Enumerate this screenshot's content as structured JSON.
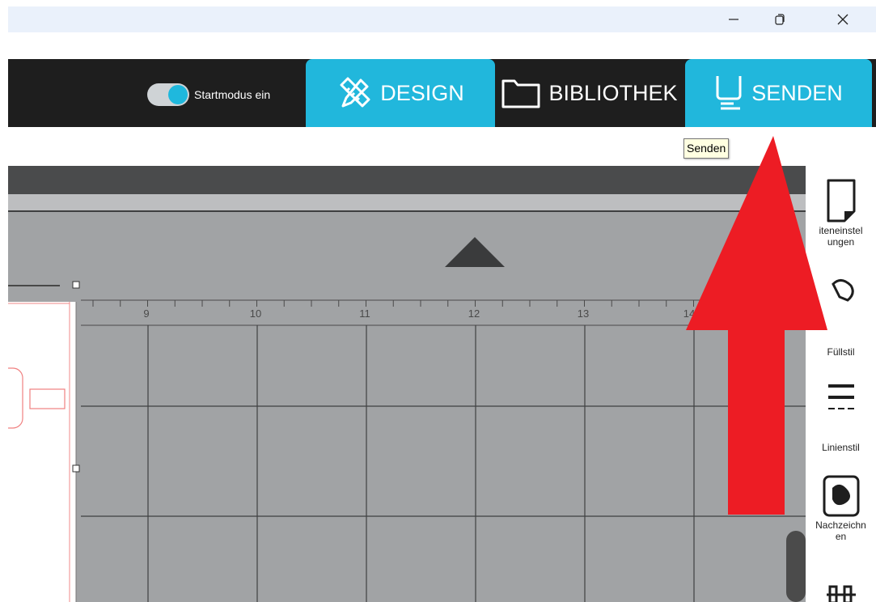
{
  "window": {
    "controls": {
      "minimize_icon": "minimize-icon",
      "maximize_icon": "restore-icon",
      "close_icon": "close-icon"
    }
  },
  "header": {
    "startmode": {
      "label": "Startmodus ein",
      "on": true
    },
    "tabs": [
      {
        "label": "DESIGN",
        "icon": "design-pencil-ruler-icon",
        "active": true
      },
      {
        "label": "BIBLIOTHEK",
        "icon": "folder-icon",
        "active": false
      },
      {
        "label": "SENDEN",
        "icon": "send-machine-icon",
        "active": true
      }
    ],
    "tooltip": "Senden"
  },
  "ruler": {
    "ticks": [
      "9",
      "10",
      "11",
      "12",
      "13",
      "14"
    ]
  },
  "tools": [
    {
      "label": "iteneinstel\nungen",
      "icon": "page-settings-icon"
    },
    {
      "label": "Füllstil",
      "icon": "fill-style-icon"
    },
    {
      "label": "Linienstil",
      "icon": "line-style-icon"
    },
    {
      "label": "Nachzeichn\nen",
      "icon": "trace-icon"
    },
    {
      "label": "",
      "icon": "align-icon"
    }
  ],
  "colors": {
    "accent": "#21b7dc",
    "header_bg": "#1e1e1e",
    "canvas_bg": "#a1a3a5",
    "annotation_arrow": "#ed1c24"
  }
}
